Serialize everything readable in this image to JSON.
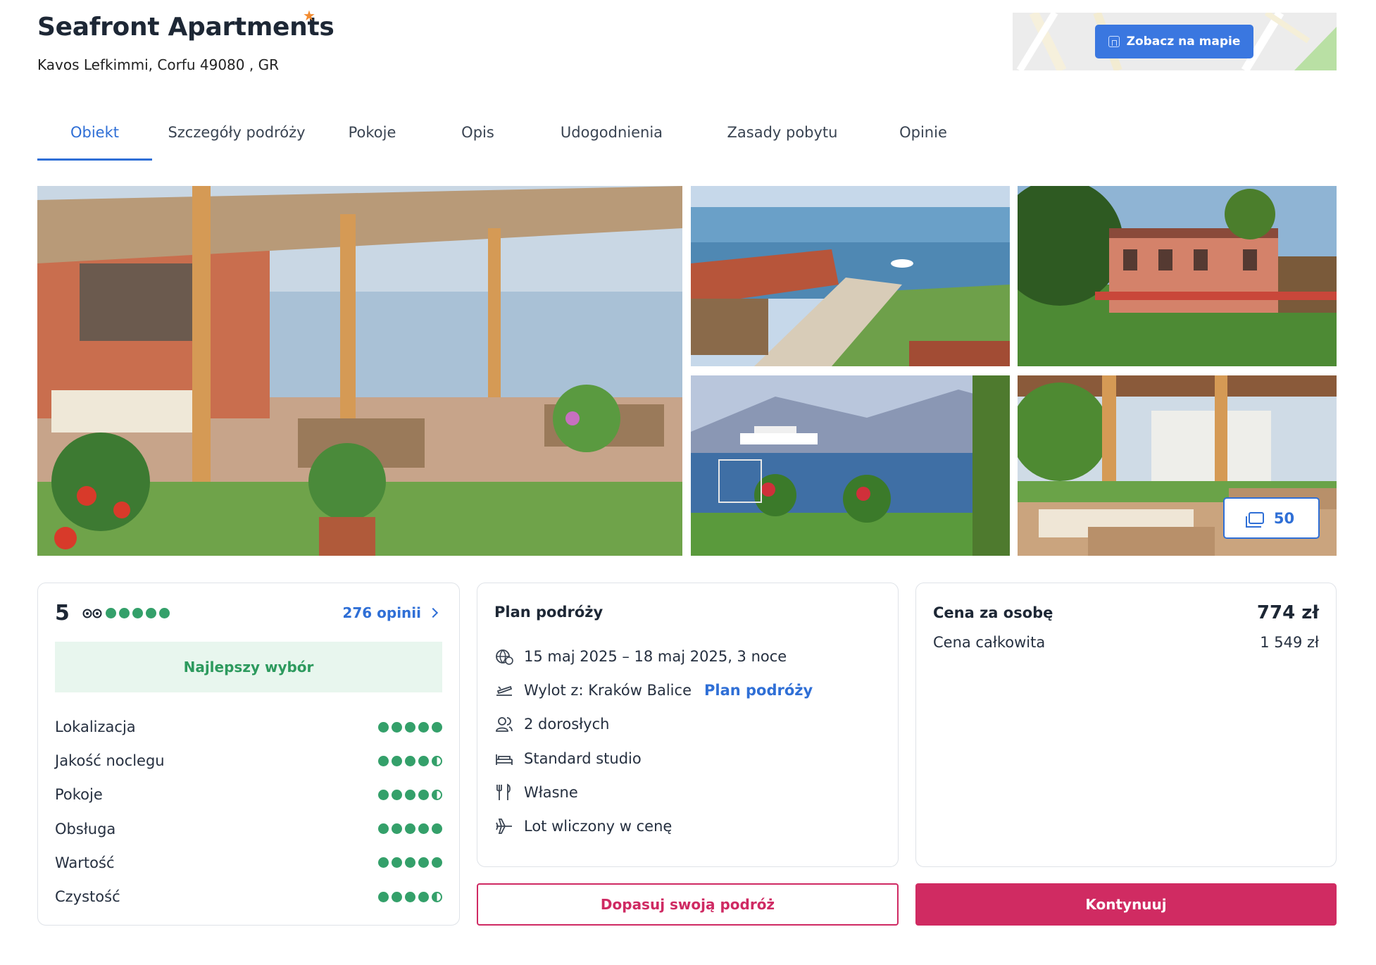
{
  "header": {
    "title": "Seafront Apartments",
    "star_icon": "star-icon",
    "address": "Kavos Lefkimmi, Corfu 49080 , GR",
    "map_button_label": "Zobacz na mapie"
  },
  "tabs": [
    {
      "label": "Obiekt",
      "active": true
    },
    {
      "label": "Szczegóły podróży",
      "active": false
    },
    {
      "label": "Pokoje",
      "active": false
    },
    {
      "label": "Opis",
      "active": false
    },
    {
      "label": "Udogodnienia",
      "active": false
    },
    {
      "label": "Zasady pobytu",
      "active": false
    },
    {
      "label": "Opinie",
      "active": false
    }
  ],
  "gallery": {
    "photo_count": "50"
  },
  "rating": {
    "score": "5",
    "stars": 5,
    "reviews_label": "276 opinii",
    "badge": "Najlepszy wybór",
    "categories": [
      {
        "label": "Lokalizacja",
        "value": 5
      },
      {
        "label": "Jakość noclegu",
        "value": 4.5
      },
      {
        "label": "Pokoje",
        "value": 4.5
      },
      {
        "label": "Obsługa",
        "value": 5
      },
      {
        "label": "Wartość",
        "value": 5
      },
      {
        "label": "Czystość",
        "value": 4.5
      }
    ]
  },
  "plan": {
    "heading": "Plan podróży",
    "dates": "15 maj 2025 – 18 maj 2025, 3 noce",
    "departure": "Wylot z: Kraków Balice",
    "departure_link": "Plan podróży",
    "guests": "2 dorosłych",
    "room": "Standard studio",
    "meals": "Własne",
    "flight": "Lot wliczony w cenę"
  },
  "price": {
    "per_person_label": "Cena za osobę",
    "per_person_value": "774 zł",
    "total_label": "Cena całkowita",
    "total_value": "1 549 zł"
  },
  "actions": {
    "customize_label": "Dopasuj swoją podróż",
    "continue_label": "Kontynuuj"
  },
  "colors": {
    "primary_blue": "#2f6fd6",
    "accent_pink": "#d02b62",
    "rating_green": "#34a06a"
  }
}
